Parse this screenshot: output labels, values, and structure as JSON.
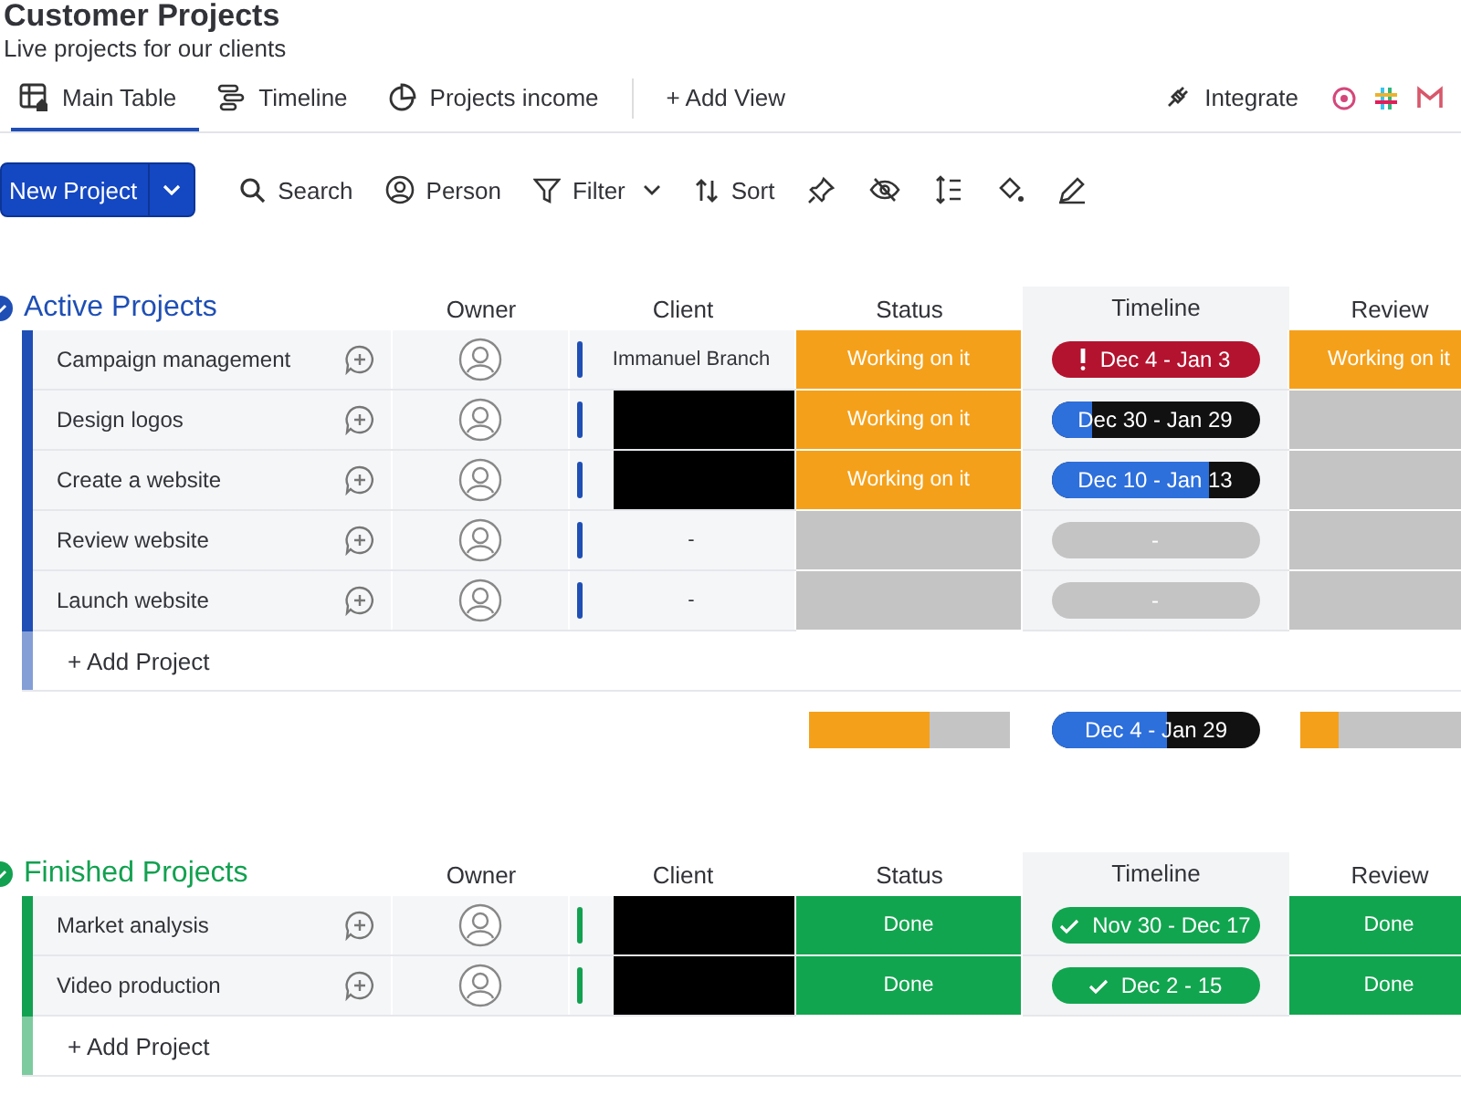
{
  "board": {
    "title": "Customer Projects",
    "description": "Live projects for our clients"
  },
  "views": [
    {
      "label": "Main Table",
      "selected": true
    },
    {
      "label": "Timeline",
      "selected": false
    },
    {
      "label": "Projects income",
      "selected": false
    }
  ],
  "add_view": "+ Add View",
  "integrate": "Integrate",
  "toolbar": {
    "primary": "New Project",
    "actions": [
      {
        "label": "Search",
        "dropdown": false
      },
      {
        "label": "Person",
        "dropdown": false
      },
      {
        "label": "Filter",
        "dropdown": true
      },
      {
        "label": "Sort",
        "dropdown": false
      }
    ]
  },
  "groups": [
    {
      "title": "Active Projects",
      "color": "#1f4fb5",
      "columns": [
        "Owner",
        "Client",
        "Status",
        "Timeline",
        "Review"
      ],
      "rows": [
        {
          "name": "Campaign management",
          "client": "Immanuel Branch",
          "client_redacted": false,
          "status": {
            "label": "Working on it",
            "color": "#f5a01a"
          },
          "timeline": {
            "kind": "overdue",
            "label": "Dec 4 - Jan 3"
          },
          "review": {
            "label": "Working on it",
            "color": "#f5a01a"
          }
        },
        {
          "name": "Design logos",
          "client_redacted": true,
          "status": {
            "label": "Working on it",
            "color": "#f5a01a"
          },
          "timeline": {
            "kind": "progress",
            "label": "Dec 30 - Jan 29",
            "level": 0.2
          },
          "review": {
            "color": "#c4c4c4"
          }
        },
        {
          "name": "Create a website",
          "client_redacted": true,
          "status": {
            "label": "Working on it",
            "color": "#f5a01a"
          },
          "timeline": {
            "kind": "progress",
            "label": "Dec 10 - Jan 13",
            "level": 0.76
          },
          "review": {
            "color": "#c4c4c4"
          }
        },
        {
          "name": "Review website",
          "client": "-",
          "client_redacted": false,
          "status": {
            "color": "#c4c4c4"
          },
          "timeline": {
            "kind": "empty",
            "label": "-"
          },
          "review": {
            "color": "#c4c4c4"
          }
        },
        {
          "name": "Launch website",
          "client": "-",
          "client_redacted": false,
          "status": {
            "color": "#c4c4c4"
          },
          "timeline": {
            "kind": "empty",
            "label": "-"
          },
          "review": {
            "color": "#c4c4c4"
          }
        }
      ],
      "add_label": "+ Add Project",
      "summary": {
        "status": [
          {
            "color": "#f5a01a",
            "level": 0.6
          },
          {
            "color": "#c4c4c4",
            "level": 0.4
          }
        ],
        "timeline": {
          "label": "Dec 4 - Jan 29",
          "level": 0.55
        },
        "review": [
          {
            "color": "#f5a01a",
            "level": 0.2
          },
          {
            "color": "#c4c4c4",
            "level": 0.8
          }
        ]
      }
    },
    {
      "title": "Finished Projects",
      "color": "#12a150",
      "columns": [
        "Owner",
        "Client",
        "Status",
        "Timeline",
        "Review"
      ],
      "rows": [
        {
          "name": "Market analysis",
          "client_redacted": true,
          "status": {
            "label": "Done",
            "color": "#12a54f"
          },
          "timeline": {
            "kind": "done",
            "label": "Nov 30 - Dec 17"
          },
          "review": {
            "label": "Done",
            "color": "#12a54f"
          }
        },
        {
          "name": "Video production",
          "client_redacted": true,
          "status": {
            "label": "Done",
            "color": "#12a54f"
          },
          "timeline": {
            "kind": "done",
            "label": "Dec 2 - 15"
          },
          "review": {
            "label": "Done",
            "color": "#12a54f"
          }
        }
      ],
      "add_label": "+ Add Project"
    }
  ]
}
